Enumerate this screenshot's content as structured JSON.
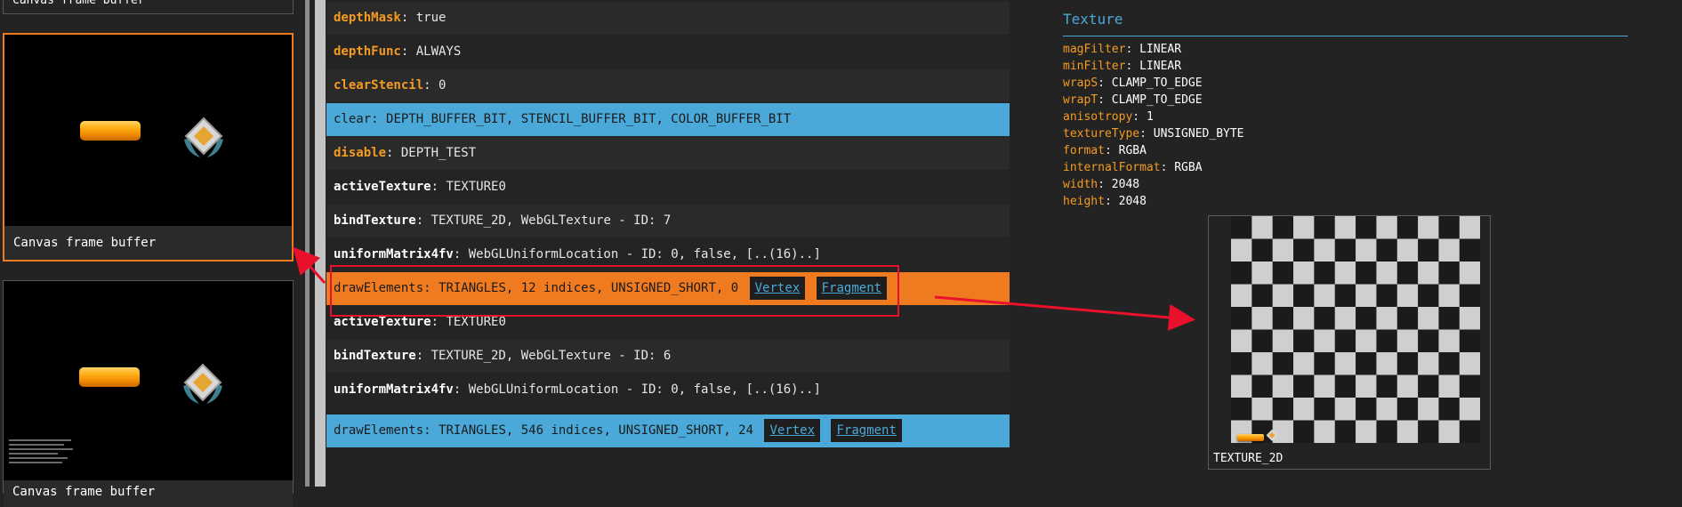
{
  "left_panel": {
    "frames": [
      {
        "label": "Canvas frame buffer"
      },
      {
        "label": "Canvas frame buffer"
      },
      {
        "label": "Canvas frame buffer"
      }
    ]
  },
  "commands": [
    {
      "fn": "depthMask",
      "args": "true"
    },
    {
      "fn": "depthFunc",
      "args": "ALWAYS"
    },
    {
      "fn": "clearStencil",
      "args": "0"
    },
    {
      "fn": "clear",
      "args": "DEPTH_BUFFER_BIT, STENCIL_BUFFER_BIT, COLOR_BUFFER_BIT"
    },
    {
      "fn": "disable",
      "args": "DEPTH_TEST"
    },
    {
      "fn": "activeTexture",
      "args": "TEXTURE0"
    },
    {
      "fn": "bindTexture",
      "args": "TEXTURE_2D, WebGLTexture - ID: 7"
    },
    {
      "fn": "uniformMatrix4fv",
      "args": "WebGLUniformLocation - ID: 0, false, [..(16)..]"
    },
    {
      "fn": "drawElements",
      "args": "TRIANGLES, 12 indices, UNSIGNED_SHORT, 0",
      "vertex": "Vertex",
      "fragment": "Fragment"
    },
    {
      "fn": "activeTexture",
      "args": "TEXTURE0"
    },
    {
      "fn": "bindTexture",
      "args": "TEXTURE_2D, WebGLTexture - ID: 6"
    },
    {
      "fn": "uniformMatrix4fv",
      "args": "WebGLUniformLocation - ID: 0, false, [..(16)..]"
    },
    {
      "fn": "drawElements",
      "args": "TRIANGLES, 546 indices, UNSIGNED_SHORT, 24",
      "vertex": "Vertex",
      "fragment": "Fragment"
    }
  ],
  "texture": {
    "title": "Texture",
    "props": [
      {
        "k": "magFilter",
        "v": "LINEAR"
      },
      {
        "k": "minFilter",
        "v": "LINEAR"
      },
      {
        "k": "wrapS",
        "v": "CLAMP_TO_EDGE"
      },
      {
        "k": "wrapT",
        "v": "CLAMP_TO_EDGE"
      },
      {
        "k": "anisotropy",
        "v": "1"
      },
      {
        "k": "textureType",
        "v": "UNSIGNED_BYTE"
      },
      {
        "k": "format",
        "v": "RGBA"
      },
      {
        "k": "internalFormat",
        "v": "RGBA"
      },
      {
        "k": "width",
        "v": "2048"
      },
      {
        "k": "height",
        "v": "2048"
      }
    ],
    "caption": "TEXTURE_2D"
  },
  "colors": {
    "orange": "#f07a20",
    "blue": "#4aa9d9",
    "annotation_red": "#e8102a"
  }
}
